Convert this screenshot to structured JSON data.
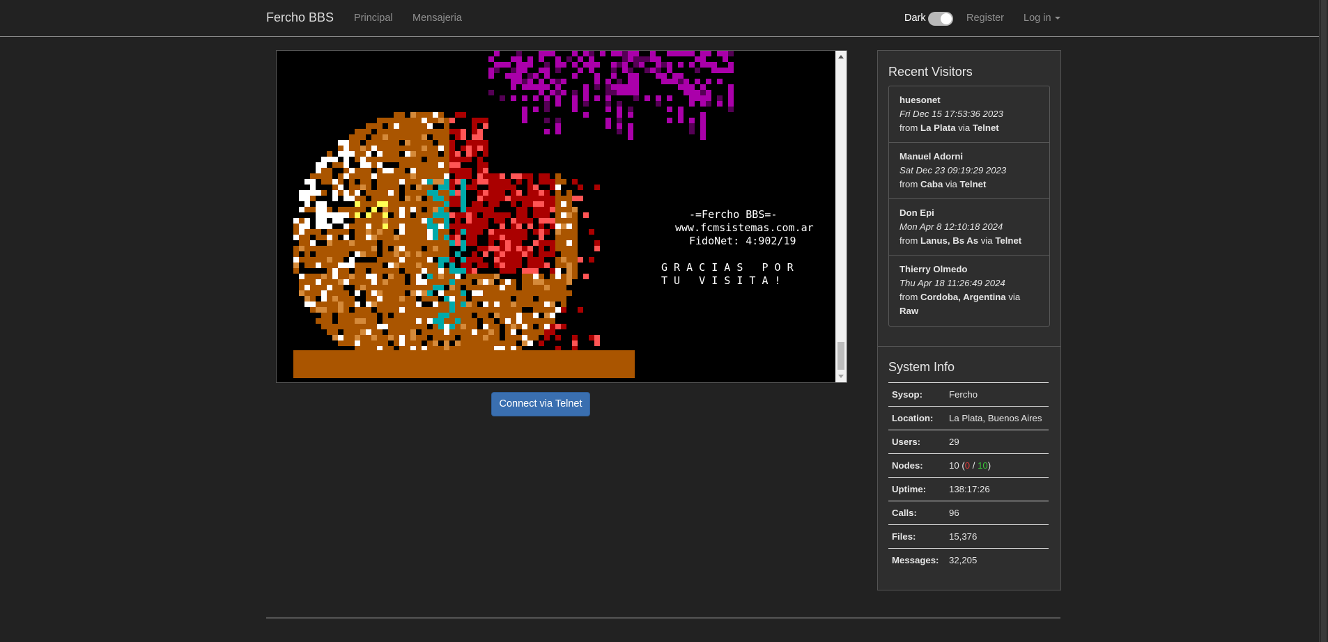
{
  "navbar": {
    "brand": "Fercho BBS",
    "links": [
      "Principal",
      "Mensajeria"
    ],
    "dark_label": "Dark",
    "register": "Register",
    "login": "Log in"
  },
  "terminal": {
    "lines": [
      "-=Fercho BBS=-",
      "www.fcmsistemas.com.ar",
      "FidoNet: 4:902/19"
    ],
    "thanks": [
      "G R A C I A S   P O R",
      "T U   V I S I T A !"
    ]
  },
  "connect_button": "Connect via Telnet",
  "recent_visitors": {
    "title": "Recent Visitors",
    "items": [
      {
        "name": "huesonet",
        "date": "Fri Dec 15 17:53:36 2023",
        "from_word": "from",
        "place": "La Plata",
        "via_word": "via",
        "method": "Telnet"
      },
      {
        "name": "Manuel Adorni",
        "date": "Sat Dec 23 09:19:29 2023",
        "from_word": "from",
        "place": "Caba",
        "via_word": "via",
        "method": "Telnet"
      },
      {
        "name": "Don Epi",
        "date": "Mon Apr 8 12:10:18 2024",
        "from_word": "from",
        "place": "Lanus, Bs As",
        "via_word": "via",
        "method": "Telnet"
      },
      {
        "name": "Thierry Olmedo",
        "date": "Thu Apr 18 11:26:49 2024",
        "from_word": "from",
        "place": "Cordoba, Argentina",
        "via_word": "via",
        "method": "Raw"
      }
    ]
  },
  "system_info": {
    "title": "System Info",
    "sysop_label": "Sysop:",
    "sysop": "Fercho",
    "location_label": "Location:",
    "location": "La Plata, Buenos Aires",
    "users_label": "Users:",
    "users": "29",
    "nodes_label": "Nodes:",
    "nodes_total": "10",
    "nodes_busy": "0",
    "nodes_free": "10",
    "uptime_label": "Uptime:",
    "uptime": "138:17:26",
    "calls_label": "Calls:",
    "calls": "96",
    "files_label": "Files:",
    "files": "15,376",
    "messages_label": "Messages:",
    "messages": "32,205"
  },
  "colors": {
    "background": "#222222",
    "button": "#3a6fb0",
    "nodes_busy": "#e23a3a",
    "nodes_free": "#38c338",
    "art_brown": "#aa5500",
    "art_red": "#aa0000",
    "art_magenta": "#aa00aa",
    "art_cyan": "#00aaaa"
  }
}
